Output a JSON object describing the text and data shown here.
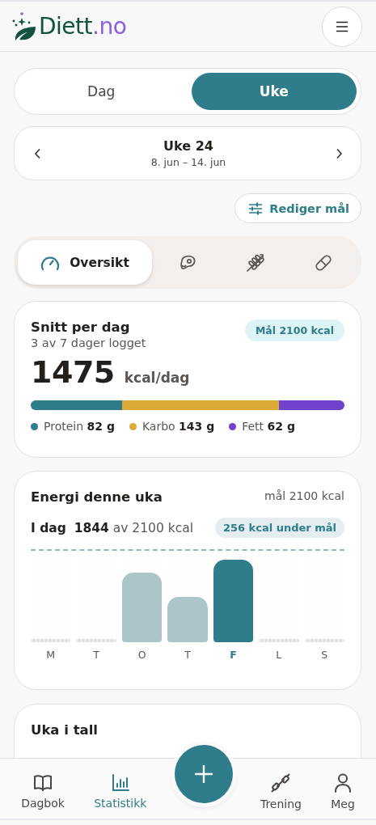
{
  "header": {
    "logo": {
      "name": "Diett",
      "suffix": ".no"
    }
  },
  "period": [
    {
      "label": "Dag",
      "selected": false
    },
    {
      "label": "Uke",
      "selected": true
    }
  ],
  "week": {
    "title": "Uke 24",
    "range": "8. jun – 14. jun"
  },
  "edit_goals_button": "Rediger mål",
  "category_tabs": [
    {
      "kind": "overview",
      "label": "Oversikt",
      "selected": true
    },
    {
      "kind": "protein",
      "selected": false
    },
    {
      "kind": "carbs",
      "selected": false
    },
    {
      "kind": "supplements",
      "selected": false
    }
  ],
  "summary": {
    "title": "Snitt per dag",
    "subtitle": "3 av 7 dager logget",
    "goal_badge": "Mål 2100 kcal",
    "value": "1475",
    "unit": "kcal/dag",
    "macros": [
      {
        "name": "Protein",
        "amount": "82 g",
        "color": "#2f7d8a",
        "level": 0.29
      },
      {
        "name": "Karbo",
        "amount": "143 g",
        "color": "#dcaa38",
        "level": 0.5
      },
      {
        "name": "Fett",
        "amount": "62 g",
        "color": "#7143cc",
        "level": 0.21
      }
    ]
  },
  "energy": {
    "title": "Energi denne uka",
    "goal": "mål 2100 kcal",
    "today": "**I dag**  **1844** av 2100 kcal",
    "status_badge": "256 kcal under mål",
    "days": [
      {
        "label": "M",
        "level": 0,
        "selected": false
      },
      {
        "label": "T",
        "level": 0,
        "selected": false
      },
      {
        "label": "O",
        "level": 0.76,
        "selected": false
      },
      {
        "label": "T",
        "level": 0.5,
        "selected": false
      },
      {
        "label": "F",
        "level": 0.9,
        "selected": true
      },
      {
        "label": "L",
        "level": 0,
        "selected": false
      },
      {
        "label": "S",
        "level": 0,
        "selected": false
      }
    ]
  },
  "numbers": {
    "title": "Uka i tall"
  },
  "nav": [
    {
      "kind": "diary",
      "label": "Dagbok",
      "selected": false
    },
    {
      "kind": "stats",
      "label": "Statistikk",
      "selected": true
    },
    {
      "kind": "add"
    },
    {
      "kind": "training",
      "label": "Trening",
      "selected": false
    },
    {
      "kind": "profile",
      "label": "Meg",
      "selected": false
    }
  ]
}
